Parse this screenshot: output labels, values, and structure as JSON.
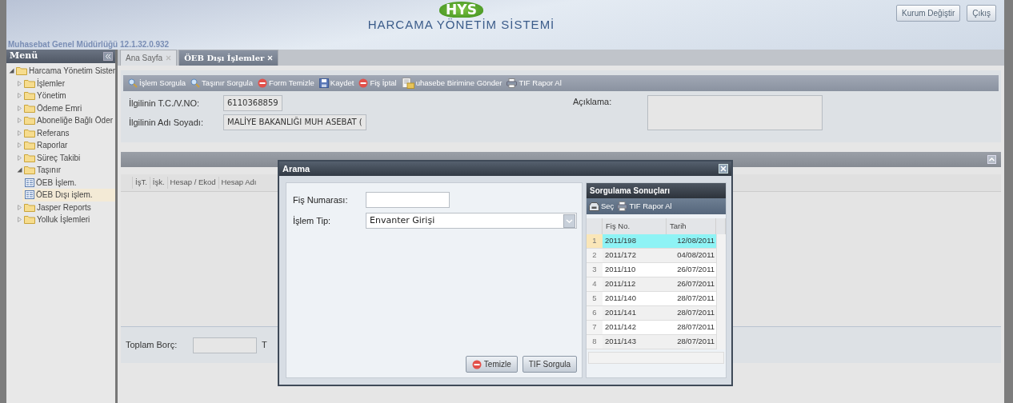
{
  "header": {
    "subtitle": "Muhasebat Genel Müdürlüğü 12.1.32.0.932",
    "logo": "HYS",
    "system_name": "HARCAMA YÖNETİM SİSTEMİ",
    "buttons": [
      "Kurum Değiştir",
      "Çıkış"
    ]
  },
  "sidebar": {
    "title": "Menü",
    "tree": [
      {
        "label": "Harcama Yönetim Sister",
        "kind": "folder",
        "expanded": true,
        "selected": false,
        "children": [
          {
            "label": "İşlemler",
            "kind": "folder",
            "expanded": false,
            "selected": false
          },
          {
            "label": "Yönetim",
            "kind": "folder",
            "expanded": false,
            "selected": false
          },
          {
            "label": "Ödeme Emri",
            "kind": "folder",
            "expanded": false,
            "selected": false
          },
          {
            "label": "Aboneliğe Bağlı Öder",
            "kind": "folder",
            "expanded": false,
            "selected": false
          },
          {
            "label": "Referans",
            "kind": "folder",
            "expanded": false,
            "selected": false
          },
          {
            "label": "Raporlar",
            "kind": "folder",
            "expanded": false,
            "selected": false
          },
          {
            "label": "Süreç Takibi",
            "kind": "folder",
            "expanded": false,
            "selected": false
          },
          {
            "label": "Taşınır",
            "kind": "folder",
            "expanded": true,
            "selected": false,
            "children": [
              {
                "label": "ÖEB İşlem.",
                "kind": "page",
                "selected": false
              },
              {
                "label": "ÖEB Dışı işlem.",
                "kind": "page",
                "selected": true
              }
            ]
          },
          {
            "label": "Jasper Reports",
            "kind": "folder",
            "expanded": false,
            "selected": false
          },
          {
            "label": "Yolluk İşlemleri",
            "kind": "folder",
            "expanded": false,
            "selected": false
          }
        ]
      }
    ]
  },
  "tabs": [
    {
      "label": "Ana Sayfa",
      "selected": false
    },
    {
      "label": "ÖEB Dışı İşlemler",
      "selected": true
    }
  ],
  "toolbar": [
    {
      "label": "İşlem Sorgula",
      "kind": "search"
    },
    {
      "label": "Taşınır Sorgula",
      "kind": "search"
    },
    {
      "label": "Form Temizle",
      "kind": "clear"
    },
    {
      "label": "Kaydet",
      "kind": "save"
    },
    {
      "label": "Fiş İptal",
      "kind": "clear"
    },
    {
      "label": "uhasebe Birimine Gönder",
      "kind": "send"
    },
    {
      "label": "TIF Rapor Al",
      "kind": "print"
    }
  ],
  "form": {
    "fields": [
      {
        "label": "İlgilinin T.C./V.NO:",
        "value": "6110368859"
      },
      {
        "label": "İlgilinin Adı Soyadı:",
        "value": "MALİYE BAKANLIĞI MUH ASEBAT ("
      }
    ],
    "description": {
      "label": "Açıklama:"
    }
  },
  "grid": {
    "columns": [
      "İşT.",
      "İşk.",
      "Hesap / Ekod",
      "Hesap Adı"
    ]
  },
  "footer": {
    "label": "Toplam Borç:",
    "label_2": "T"
  },
  "dialog": {
    "title": "Arama",
    "fields": [
      {
        "label": "Fiş Numarası:",
        "kind": "text"
      },
      {
        "label": "İşlem Tip:",
        "kind": "select",
        "value": "Envanter Girişi"
      }
    ],
    "buttons": [
      {
        "label": "Temizle",
        "kind": "clear"
      },
      {
        "label": "TIF Sorgula",
        "kind": "plain"
      }
    ],
    "results": {
      "title": "Sorgulama Sonuçları",
      "toolbar": [
        {
          "label": "Seç",
          "kind": "select"
        },
        {
          "label": "TIF Rapor Al",
          "kind": "print"
        }
      ],
      "columns": [
        "Fiş No.",
        "Tarih"
      ],
      "rows": [
        {
          "number": "1",
          "fis_no": "2011/198",
          "date": "12/08/2011",
          "selected": true
        },
        {
          "number": "2",
          "fis_no": "2011/172",
          "date": "04/08/2011",
          "selected": false
        },
        {
          "number": "3",
          "fis_no": "2011/110",
          "date": "26/07/2011",
          "selected": false
        },
        {
          "number": "4",
          "fis_no": "2011/112",
          "date": "26/07/2011",
          "selected": false
        },
        {
          "number": "5",
          "fis_no": "2011/140",
          "date": "28/07/2011",
          "selected": false
        },
        {
          "number": "6",
          "fis_no": "2011/141",
          "date": "28/07/2011",
          "selected": false
        },
        {
          "number": "7",
          "fis_no": "2011/142",
          "date": "28/07/2011",
          "selected": false
        },
        {
          "number": "8",
          "fis_no": "2011/143",
          "date": "28/07/2011",
          "selected": false
        }
      ]
    }
  }
}
